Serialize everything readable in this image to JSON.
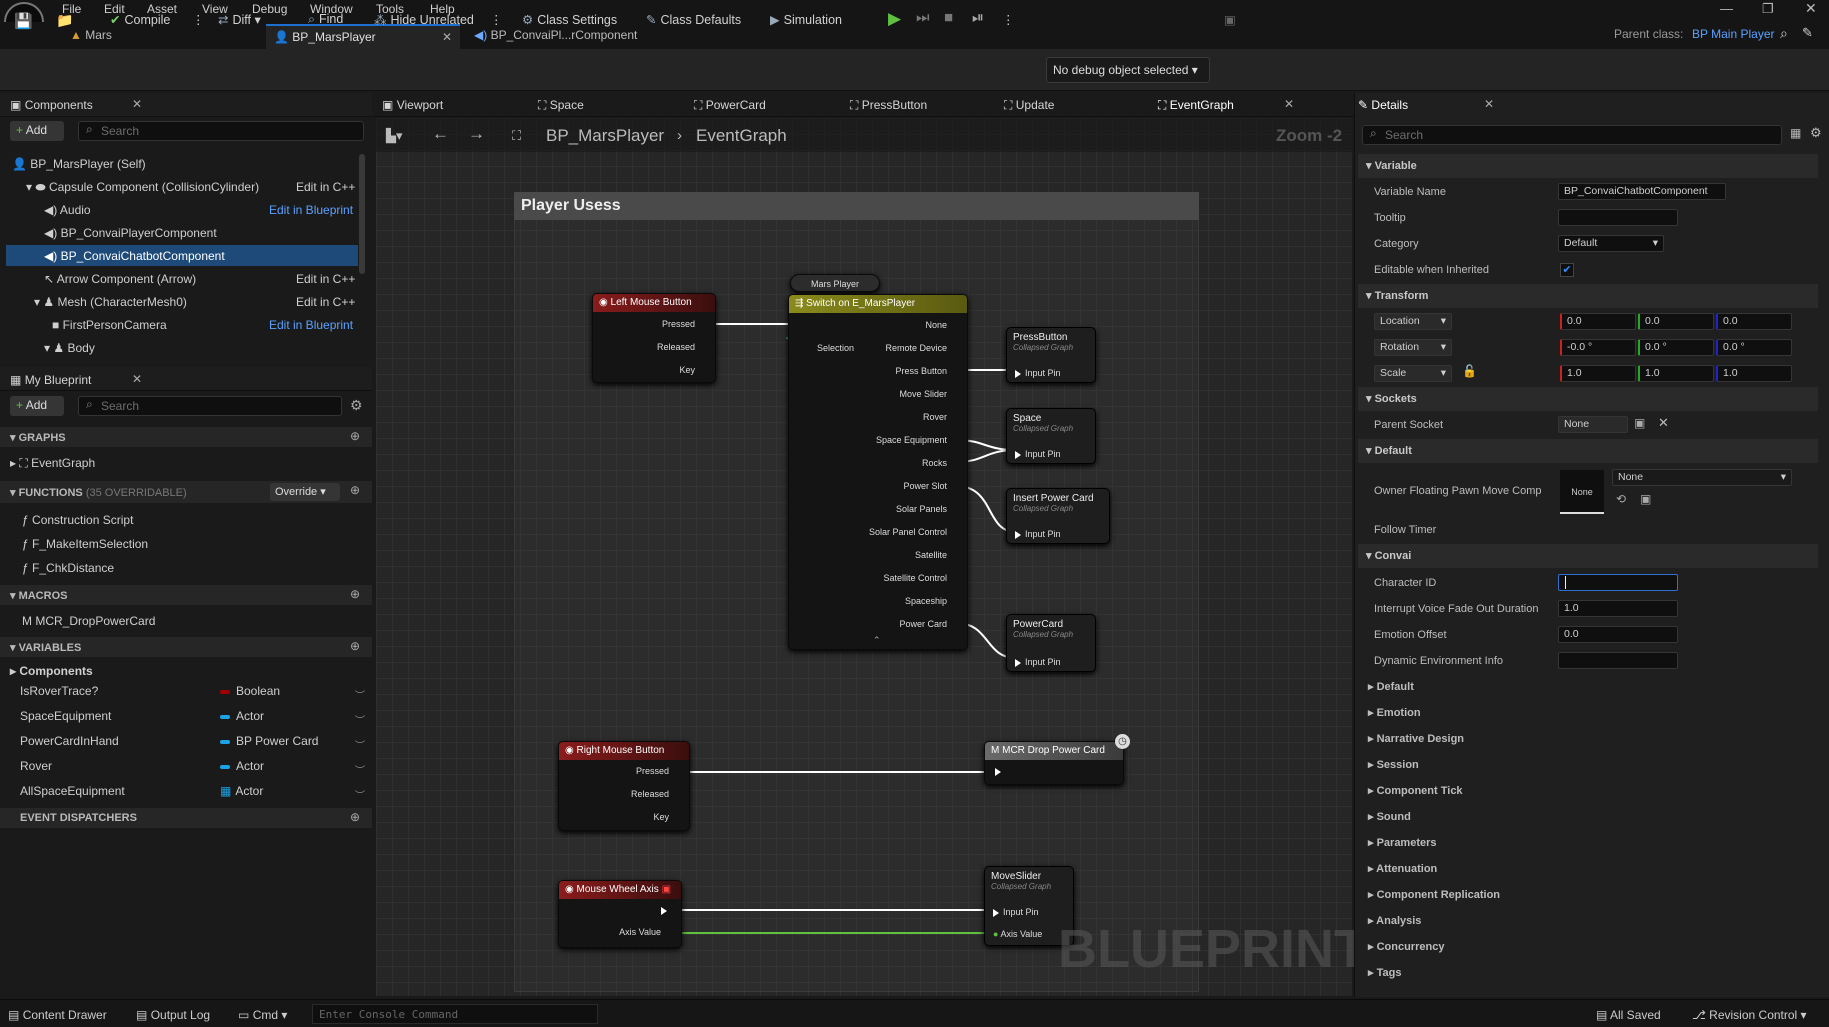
{
  "menu": [
    "File",
    "Edit",
    "Asset",
    "View",
    "Debug",
    "Window",
    "Tools",
    "Help"
  ],
  "doc_tabs": [
    "Mars",
    "BP_MarsPlayer",
    "BP_ConvaiPl...rComponent"
  ],
  "parent_class": {
    "label": "Parent class:",
    "value": "BP Main Player"
  },
  "toolbar": {
    "compile": "Compile",
    "diff": "Diff",
    "find": "Find",
    "hide_unrelated": "Hide Unrelated",
    "class_settings": "Class Settings",
    "class_defaults": "Class Defaults",
    "simulation": "Simulation",
    "debug_object": "No debug object selected"
  },
  "components": {
    "tab": "Components",
    "add": "Add",
    "search_placeholder": "Search",
    "items": [
      {
        "label": "BP_MarsPlayer (Self)",
        "link": ""
      },
      {
        "label": "Capsule Component (CollisionCylinder)",
        "link": "Edit in C++"
      },
      {
        "label": "Audio",
        "link": "Edit in Blueprint"
      },
      {
        "label": "BP_ConvaiPlayerComponent",
        "link": ""
      },
      {
        "label": "BP_ConvaiChatbotComponent",
        "link": ""
      },
      {
        "label": "Arrow Component (Arrow)",
        "link": "Edit in C++"
      },
      {
        "label": "Mesh (CharacterMesh0)",
        "link": "Edit in C++"
      },
      {
        "label": "FirstPersonCamera",
        "link": "Edit in Blueprint"
      },
      {
        "label": "Body",
        "link": ""
      }
    ]
  },
  "my_blueprint": {
    "tab": "My Blueprint",
    "add": "Add",
    "search_placeholder": "Search",
    "graphs_label": "GRAPHS",
    "graph_item": "EventGraph",
    "functions_label": "FUNCTIONS",
    "functions_count": "(35 OVERRIDABLE)",
    "override": "Override",
    "functions": [
      "Construction Script",
      "F_MakeItemSelection",
      "F_ChkDistance"
    ],
    "macros_label": "MACROS",
    "macros": [
      "MCR_DropPowerCard"
    ],
    "variables_label": "VARIABLES",
    "var_group": "Components",
    "variables": [
      {
        "name": "IsRoverTrace?",
        "type": "Boolean",
        "color": "#a00000"
      },
      {
        "name": "SpaceEquipment",
        "type": "Actor",
        "color": "#1aa3e6"
      },
      {
        "name": "PowerCardInHand",
        "type": "BP Power Card",
        "color": "#1aa3e6"
      },
      {
        "name": "Rover",
        "type": "Actor",
        "color": "#1aa3e6"
      },
      {
        "name": "AllSpaceEquipment",
        "type": "Actor",
        "color": "#1aa3e6"
      }
    ],
    "event_dispatchers": "EVENT DISPATCHERS"
  },
  "graph_tabs": [
    "Viewport",
    "Space",
    "PowerCard",
    "PressButton",
    "Update",
    "EventGraph"
  ],
  "graph": {
    "breadcrumb_bp": "BP_MarsPlayer",
    "breadcrumb_graph": "EventGraph",
    "zoom": "Zoom -2",
    "comment": "Player Usess",
    "watermark": "BLUEPRINT",
    "lmb": {
      "title": "Left Mouse Button",
      "pins": [
        "Pressed",
        "Released",
        "Key"
      ]
    },
    "mars_player": "Mars Player",
    "switch": {
      "title": "Switch on E_MarsPlayer",
      "selection": "Selection",
      "outs": [
        "None",
        "Remote Device",
        "Press Button",
        "Move Slider",
        "Rover",
        "Space Equipment",
        "Rocks",
        "Power Slot",
        "Solar Panels",
        "Solar Panel Control",
        "Satellite",
        "Satellite Control",
        "Spaceship",
        "Power Card"
      ]
    },
    "collapsed_sub": "Collapsed Graph",
    "input_pin": "Input Pin",
    "c_press": "PressButton",
    "c_space": "Space",
    "c_insert": "Insert Power Card",
    "c_power": "PowerCard",
    "rmb": {
      "title": "Right Mouse Button",
      "pins": [
        "Pressed",
        "Released",
        "Key"
      ]
    },
    "mcr": "MCR Drop Power Card",
    "wheel": {
      "title": "Mouse Wheel Axis",
      "pin": "Axis Value"
    },
    "move_slider": {
      "title": "MoveSlider",
      "pins": [
        "Input Pin",
        "Axis Value"
      ]
    }
  },
  "details": {
    "tab": "Details",
    "search_placeholder": "Search",
    "variable_section": "Variable",
    "variable_name_label": "Variable Name",
    "variable_name": "BP_ConvaiChatbotComponent",
    "tooltip_label": "Tooltip",
    "category_label": "Category",
    "category": "Default",
    "editable_label": "Editable when Inherited",
    "transform_section": "Transform",
    "location": "Location",
    "rotation": "Rotation",
    "scale": "Scale",
    "loc": [
      "0.0",
      "0.0",
      "0.0"
    ],
    "rot": [
      "-0.0 °",
      "0.0 °",
      "0.0 °"
    ],
    "scl": [
      "1.0",
      "1.0",
      "1.0"
    ],
    "sockets_section": "Sockets",
    "parent_socket_label": "Parent Socket",
    "parent_socket": "None",
    "default_section": "Default",
    "owner_label": "Owner Floating Pawn Move Comp",
    "owner_thumb": "None",
    "owner_value": "None",
    "follow_timer": "Follow Timer",
    "convai_section": "Convai",
    "character_id_label": "Character ID",
    "character_id": "",
    "interrupt_label": "Interrupt Voice Fade Out Duration",
    "interrupt": "1.0",
    "emotion_offset_label": "Emotion Offset",
    "emotion_offset": "0.0",
    "dynamic_env_label": "Dynamic Environment Info",
    "collapsed": [
      "Default",
      "Emotion",
      "Narrative Design",
      "Session",
      "Component Tick",
      "Sound",
      "Parameters",
      "Attenuation",
      "Component Replication",
      "Analysis",
      "Concurrency",
      "Tags"
    ]
  },
  "statusbar": {
    "content_drawer": "Content Drawer",
    "output_log": "Output Log",
    "cmd": "Cmd",
    "console_placeholder": "Enter Console Command",
    "all_saved": "All Saved",
    "revision_control": "Revision Control"
  }
}
